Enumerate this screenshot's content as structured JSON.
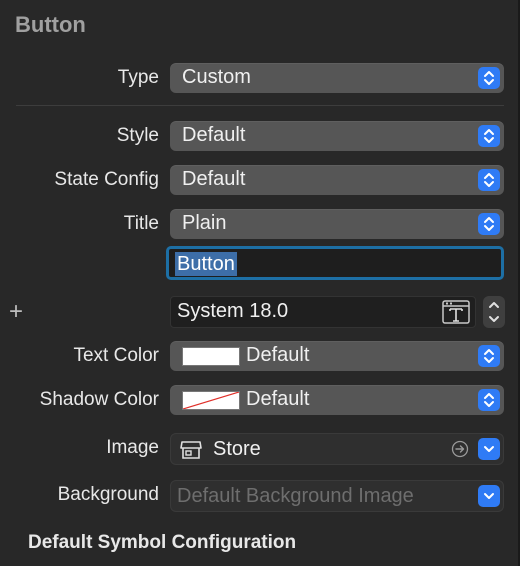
{
  "section_title": "Button",
  "rows": {
    "type": {
      "label": "Type",
      "value": "Custom"
    },
    "style": {
      "label": "Style",
      "value": "Default"
    },
    "state_config": {
      "label": "State Config",
      "value": "Default"
    },
    "title": {
      "label": "Title",
      "value": "Plain"
    },
    "title_text": "Button",
    "font": "System 18.0",
    "text_color": {
      "label": "Text Color",
      "value": "Default"
    },
    "shadow_color": {
      "label": "Shadow Color",
      "value": "Default"
    },
    "image": {
      "label": "Image",
      "value": "Store"
    },
    "background": {
      "label": "Background",
      "placeholder": "Default Background Image"
    }
  },
  "subsection_title": "Default Symbol Configuration",
  "plus_symbol": "+",
  "colors": {
    "accent": "#2f7bf5",
    "focus_ring": "#1d6fa5",
    "selection": "#3d6ea8",
    "panel_bg": "#282828"
  }
}
